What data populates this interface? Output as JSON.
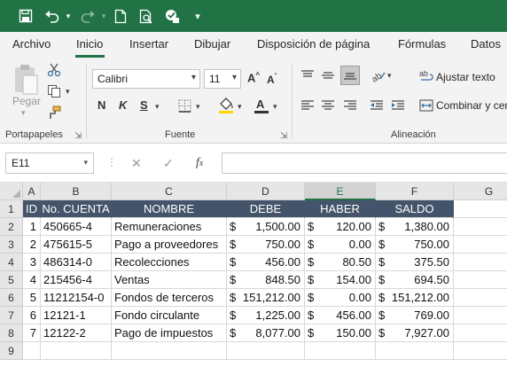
{
  "ribbon_tabs": [
    "Archivo",
    "Inicio",
    "Insertar",
    "Dibujar",
    "Disposición de página",
    "Fórmulas",
    "Datos"
  ],
  "clipboard": {
    "paste_label": "Pegar",
    "group_label": "Portapapeles"
  },
  "font": {
    "name": "Calibri",
    "size": "11",
    "bold": "N",
    "italic": "K",
    "underline": "S",
    "group_label": "Fuente"
  },
  "alignment": {
    "wrap_text": "Ajustar texto",
    "merge_center": "Combinar y cen",
    "group_label": "Alineación"
  },
  "formula_bar": {
    "name_box": "E11",
    "formula": ""
  },
  "columns": [
    "A",
    "B",
    "C",
    "D",
    "E",
    "F",
    "G"
  ],
  "rows": [
    "1",
    "2",
    "3",
    "4",
    "5",
    "6",
    "7",
    "8",
    "9"
  ],
  "table": {
    "headers": [
      "ID",
      "No. CUENTA",
      "NOMBRE",
      "DEBE",
      "HABER",
      "SALDO"
    ],
    "currency_symbol": "$",
    "records": [
      {
        "id": "1",
        "cuenta": "450665-4",
        "nombre": "Remuneraciones",
        "debe": "1,500.00",
        "haber": "120.00",
        "saldo": "1,380.00"
      },
      {
        "id": "2",
        "cuenta": "475615-5",
        "nombre": "Pago a proveedores",
        "debe": "750.00",
        "haber": "0.00",
        "saldo": "750.00"
      },
      {
        "id": "3",
        "cuenta": "486314-0",
        "nombre": "Recolecciones",
        "debe": "456.00",
        "haber": "80.50",
        "saldo": "375.50"
      },
      {
        "id": "4",
        "cuenta": "215456-4",
        "nombre": "Ventas",
        "debe": "848.50",
        "haber": "154.00",
        "saldo": "694.50"
      },
      {
        "id": "5",
        "cuenta": "11212154-0",
        "nombre": "Fondos de terceros",
        "debe": "151,212.00",
        "haber": "0.00",
        "saldo": "151,212.00"
      },
      {
        "id": "6",
        "cuenta": "12121-1",
        "nombre": "Fondo circulante",
        "debe": "1,225.00",
        "haber": "456.00",
        "saldo": "769.00"
      },
      {
        "id": "7",
        "cuenta": "12122-2",
        "nombre": "Pago de impuestos",
        "debe": "8,077.00",
        "haber": "150.00",
        "saldo": "7,927.00"
      }
    ]
  },
  "colors": {
    "title_bar": "#217346",
    "header_fill": "#44546a",
    "accent": "#217346"
  }
}
